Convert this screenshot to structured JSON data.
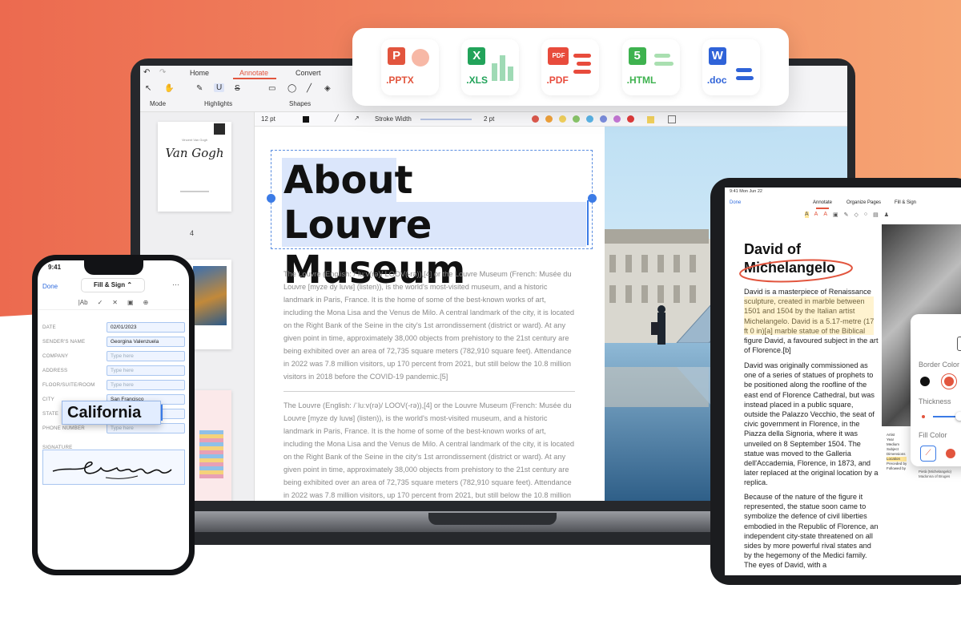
{
  "formats": [
    {
      "ext": ".PPTX",
      "letter": "P",
      "color": "#e2553e"
    },
    {
      "ext": ".XLS",
      "letter": "X",
      "color": "#22a35a"
    },
    {
      "ext": ".PDF",
      "letter": "PDF",
      "color": "#e84b3c"
    },
    {
      "ext": ".HTML",
      "letter": "5",
      "color": "#3eb24f"
    },
    {
      "ext": ".doc",
      "letter": "W",
      "color": "#2f63d8"
    }
  ],
  "laptop": {
    "tabs": {
      "home": "Home",
      "annotate": "Annotate",
      "convert": "Convert"
    },
    "groups": {
      "mode": "Mode",
      "highlights": "Highlights",
      "shapes": "Shapes"
    },
    "format_bar": {
      "font_size": "12 pt",
      "stroke_label": "Stroke Width",
      "stroke_value": "2 pt"
    },
    "color_swatches": [
      "#e05a4e",
      "#f2a33b",
      "#f4d35e",
      "#8bc86b",
      "#5bb5e8",
      "#7d8fe0",
      "#c778d8",
      "#e23b3b"
    ],
    "thumbnail": {
      "line1": "Vincent Van Gogh",
      "line2": "Van Gogh",
      "page_number": "4"
    },
    "doc": {
      "title_line1": "About",
      "title_line2": "Louvre Museum",
      "paragraph1": "The Louvre (English: /ˈluːv(rə)/ LOOV(-rə)),[4] or the Louvre Museum (French: Musée du Louvre [myze dy luvʁ] (listen)), is the world's most-visited museum, and a historic landmark in Paris, France. It is the home of some of the best-known works of art, including the Mona Lisa and the Venus de Milo. A central landmark of the city, it is located on the Right Bank of the Seine in the city's 1st arrondissement (district or ward). At any given point in time, approximately 38,000 objects from prehistory to the 21st century are being exhibited over an area of 72,735 square meters (782,910 square feet). Attendance in 2022 was 7.8 million visitors, up 170 percent from 2021, but still below the 10.8 million visitors in 2018 before the COVID-19 pandemic.[5]",
      "paragraph2": "The Louvre (English: /ˈluːv(rə)/ LOOV(-rə)),[4] or the Louvre Museum (French: Musée du Louvre [myze dy luvʁ] (listen)), is the world's most-visited museum, and a historic landmark in Paris, France. It is the home of some of the best-known works of art, including the Mona Lisa and the Venus de Milo. A central landmark of the city, it is located on the Right Bank of the Seine in the city's 1st arrondissement (district or ward). At any given point in time, approximately 38,000 objects from prehistory to the 21st century are being exhibited over an area of 72,735 square meters (782,910 square feet). Attendance in 2022 was 7.8 million visitors, up 170 percent from 2021, but still below the 10.8 million visitors in 2018 before the COVID-19 pandemic.[5]"
    }
  },
  "phone": {
    "time": "9:41",
    "done": "Done",
    "mode": "Fill & Sign",
    "toolbar_text": "|Ab",
    "fields": [
      {
        "label": "DATE",
        "value": "02/01/2023",
        "placeholder": false
      },
      {
        "label": "SENDER'S NAME",
        "value": "Georgina Valenzuela",
        "placeholder": false
      },
      {
        "label": "COMPANY",
        "value": "Type here",
        "placeholder": true
      },
      {
        "label": "ADDRESS",
        "value": "Type here",
        "placeholder": true
      },
      {
        "label": "FLOOR/SUITE/ROOM",
        "value": "Type here",
        "placeholder": true
      },
      {
        "label": "CITY",
        "value": "San Francisco",
        "placeholder": false
      },
      {
        "label": "STATE",
        "value": "",
        "placeholder": false
      },
      {
        "label": "PHONE NUMBER",
        "value": "Type here",
        "placeholder": true
      }
    ],
    "signature_label": "SIGNATURE",
    "state_overlay": "California"
  },
  "tablet": {
    "status": "9:41 Mon Jun 22",
    "done": "Done",
    "tabs": [
      "Annotate",
      "Organize Pages",
      "Fill & Sign"
    ],
    "title_line1": "David of",
    "title_line2": "Michelangelo",
    "para1": "David is a masterpiece of Renaissance sculpture, created in marble between 1501 and 1504 by the Italian artist Michelangelo. David is a 5.17-metre (17 ft 0 in)[a] marble statue of the Biblical figure David, a favoured subject in the art of Florence.[b]",
    "para2": "David was originally commissioned as one of a series of statues of prophets to be positioned along the roofline of the east end of Florence Cathedral, but was instead placed in a public square, outside the Palazzo Vecchio, the seat of civic government in Florence, in the Piazza della Signoria, where it was unveiled on 8 September 1504. The statue was moved to the Galleria dell'Accademia, Florence, in 1873, and later replaced at the original location by a replica.",
    "para3": "Because of the nature of the figure it represented, the statue soon came to symbolize the defence of civil liberties embodied in the Republic of Florence, an independent city-state threatened on all sides by more powerful rival states and by the hegemony of the Medici family. The eyes of David, with a",
    "caption_labels": [
      "Artist",
      "Year",
      "Medium",
      "Subject",
      "Dimensions",
      "Location",
      "Preceded by",
      "Followed by"
    ],
    "caption_right": [
      "Pietà (Michelangelo)",
      "Madonna of Bruges"
    ],
    "panel": {
      "border_color": "Border Color",
      "thickness": "Thickness",
      "fill_color": "Fill Color"
    }
  }
}
